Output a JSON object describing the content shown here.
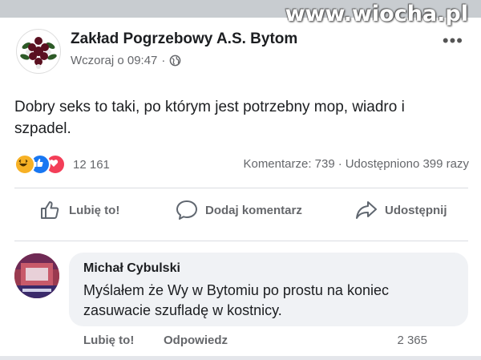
{
  "watermark": "www.wiocha.pl",
  "post": {
    "page_name": "Zakład Pogrzebowy A.S. Bytom",
    "timestamp": "Wczoraj o 09:47",
    "separator": "·",
    "more_label": "•••",
    "text": "Dobry seks to taki, po którym jest potrzebny mop, wiadro i szpadel.",
    "reaction_icons": [
      "haha-reaction-icon",
      "like-reaction-icon",
      "love-reaction-icon"
    ],
    "reaction_count": "12 161",
    "comments_label": "Komentarze: 739",
    "dot": "·",
    "shares_label": "Udostępniono 399 razy"
  },
  "actions": {
    "like": "Lubię to!",
    "comment": "Dodaj komentarz",
    "share": "Udostępnij"
  },
  "comment": {
    "author": "Michał Cybulski",
    "text": "Myślałem że Wy w Bytomiu po prostu na koniec zasuwacie szufladę w kostnicy.",
    "like": "Lubię to!",
    "reply": "Odpowiedz",
    "count": "2 365"
  },
  "colors": {
    "accent": "#1877f2",
    "love": "#f33e58",
    "haha": "#f7b125",
    "muted": "#65676b",
    "bubble": "#f0f2f5"
  }
}
